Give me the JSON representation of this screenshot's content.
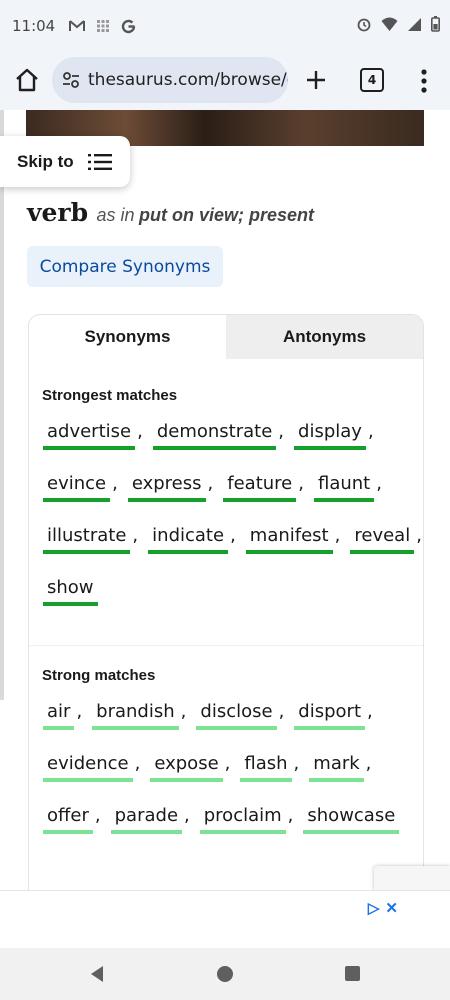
{
  "status_bar": {
    "time": "11:04",
    "left_icons": [
      "gmail-icon",
      "grid-icon",
      "google-icon"
    ],
    "right_icons": [
      "alarm-icon",
      "wifi-icon",
      "signal-icon",
      "battery-icon"
    ]
  },
  "browser": {
    "url": "thesaurus.com/browse/e",
    "tab_count": "4"
  },
  "page": {
    "skip_label": "Skip to",
    "part_of_speech": "verb",
    "as_in": "as in",
    "sense": "put on view; present",
    "compare_label": "Compare Synonyms",
    "tabs": [
      {
        "label": "Synonyms",
        "active": true
      },
      {
        "label": "Antonyms",
        "active": false
      }
    ],
    "strongest": {
      "title": "Strongest matches",
      "rows": [
        [
          {
            "w": "advertise",
            "s": ","
          },
          {
            "w": "demonstrate",
            "s": ","
          },
          {
            "w": "display",
            "s": ","
          }
        ],
        [
          {
            "w": "evince",
            "s": ","
          },
          {
            "w": "express",
            "s": ","
          },
          {
            "w": "feature",
            "s": ","
          },
          {
            "w": "flaunt",
            "s": ","
          }
        ],
        [
          {
            "w": "illustrate",
            "s": ","
          },
          {
            "w": "indicate",
            "s": ","
          },
          {
            "w": "manifest",
            "s": ","
          },
          {
            "w": "reveal",
            "s": ","
          }
        ],
        [
          {
            "w": "show",
            "s": ""
          }
        ]
      ]
    },
    "strong": {
      "title": "Strong matches",
      "rows": [
        [
          {
            "w": "air",
            "s": ","
          },
          {
            "w": "brandish",
            "s": ","
          },
          {
            "w": "disclose",
            "s": ","
          },
          {
            "w": "disport",
            "s": ","
          }
        ],
        [
          {
            "w": "evidence",
            "s": ","
          },
          {
            "w": "expose",
            "s": ","
          },
          {
            "w": "flash",
            "s": ","
          },
          {
            "w": "mark",
            "s": ","
          }
        ],
        [
          {
            "w": "offer",
            "s": ","
          },
          {
            "w": "parade",
            "s": ","
          },
          {
            "w": "proclaim",
            "s": ","
          },
          {
            "w": "showcase",
            "s": ""
          }
        ]
      ]
    }
  },
  "colors": {
    "strongest_underline": "#14a02a",
    "strong_underline": "#7de394",
    "compare_text": "#0a4a9c"
  }
}
